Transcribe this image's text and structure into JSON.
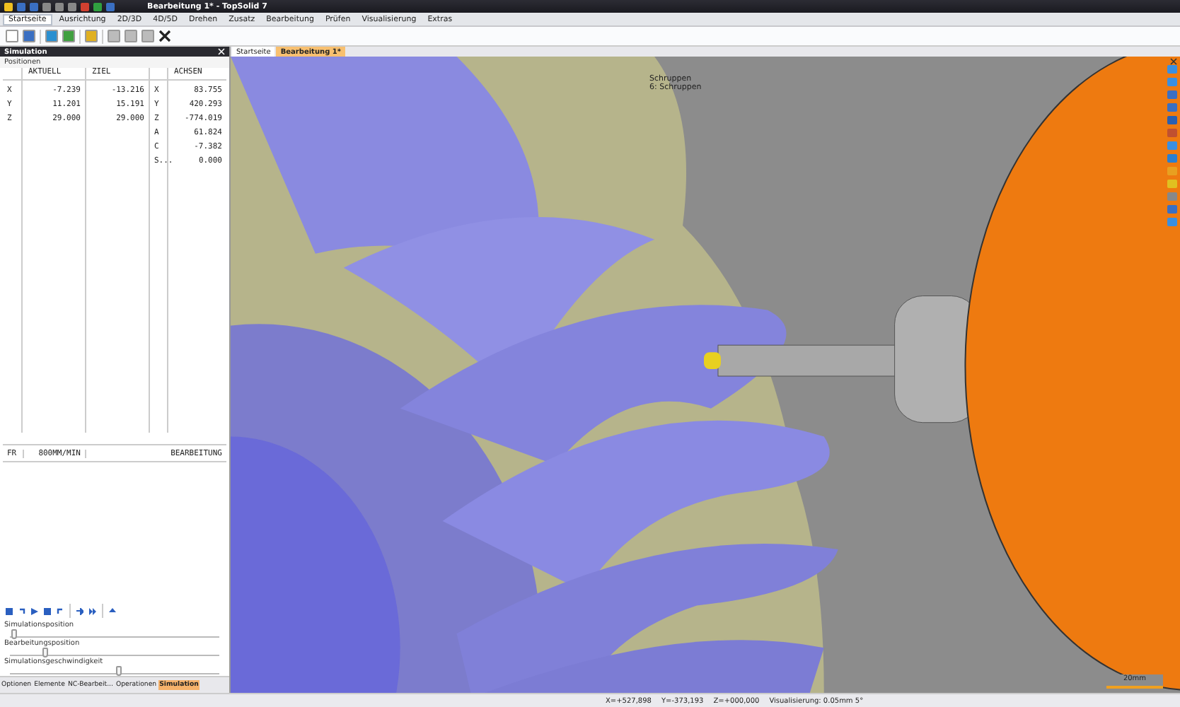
{
  "window": {
    "title": "Bearbeitung 1* - TopSolid 7"
  },
  "ribbon_tabs": [
    {
      "label": "Startseite",
      "selected": true
    },
    {
      "label": "Ausrichtung",
      "selected": false
    },
    {
      "label": "2D/3D",
      "selected": false
    },
    {
      "label": "4D/5D",
      "selected": false
    },
    {
      "label": "Drehen",
      "selected": false
    },
    {
      "label": "Zusatz",
      "selected": false
    },
    {
      "label": "Bearbeitung",
      "selected": false
    },
    {
      "label": "Prüfen",
      "selected": false
    },
    {
      "label": "Visualisierung",
      "selected": false
    },
    {
      "label": "Extras",
      "selected": false
    }
  ],
  "panel": {
    "title": "Simulation",
    "section": "Positionen",
    "columns": [
      "AKTUELL",
      "ZIEL",
      "ACHSEN"
    ],
    "positions": [
      {
        "axis": "X",
        "aktuell": "-7.239",
        "ziel": "-13.216"
      },
      {
        "axis": "Y",
        "aktuell": "11.201",
        "ziel": "15.191"
      },
      {
        "axis": "Z",
        "aktuell": "29.000",
        "ziel": "29.000"
      }
    ],
    "axes": [
      {
        "axis": "X",
        "value": "83.755"
      },
      {
        "axis": "Y",
        "value": "420.293"
      },
      {
        "axis": "Z",
        "value": "-774.019"
      },
      {
        "axis": "A",
        "value": "61.824"
      },
      {
        "axis": "C",
        "value": "-7.382"
      },
      {
        "axis": "S...",
        "value": "0.000"
      }
    ],
    "feed": {
      "label": "FR",
      "speed": "800MM/MIN",
      "mode": "BEARBEITUNG"
    },
    "sliders": [
      {
        "label": "Simulationsposition",
        "level": 0.02
      },
      {
        "label": "Bearbeitungsposition",
        "level": 0.17
      },
      {
        "label": "Simulationsgeschwindigkeit",
        "level": 0.52
      }
    ],
    "tabs": [
      {
        "label": "Optionen",
        "selected": false
      },
      {
        "label": "Elemente",
        "selected": false
      },
      {
        "label": "NC-Bearbeit...",
        "selected": false
      },
      {
        "label": "Operationen",
        "selected": false
      },
      {
        "label": "Simulation",
        "selected": true
      }
    ]
  },
  "document_tabs": [
    {
      "label": "Startseite",
      "selected": false
    },
    {
      "label": "Bearbeitung 1*",
      "selected": true
    }
  ],
  "viewport": {
    "labels": [
      "Schruppen",
      "6: Schruppen"
    ],
    "scale": "20mm"
  },
  "status_bar": {
    "x": "X=+527,898",
    "y": "Y=-373,193",
    "z": "Z=+000,000",
    "visualization": "Visualisierung: 0.05mm 5°"
  }
}
